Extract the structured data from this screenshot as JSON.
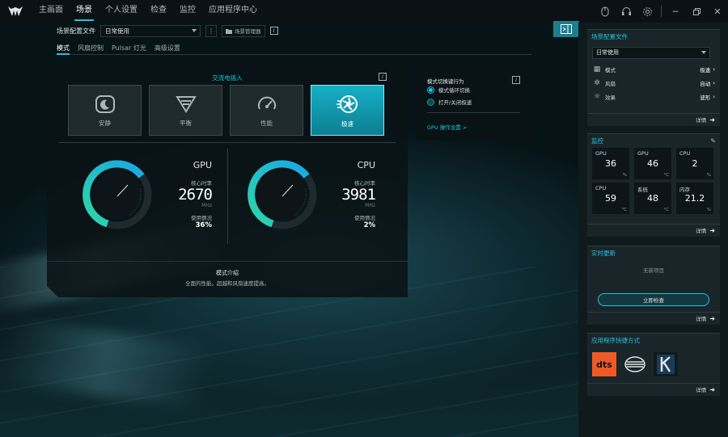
{
  "topbar": {
    "nav": [
      "主画面",
      "场景",
      "个人设置",
      "检查",
      "监控",
      "应用程序中心"
    ],
    "active_nav": "场景",
    "window_controls": [
      "minimize-icon",
      "maximize-icon",
      "close-icon"
    ],
    "icons": [
      "mouse-icon",
      "headset-icon",
      "gear-icon"
    ]
  },
  "profile": {
    "label": "场景配置文件",
    "selected": "日常使用",
    "more": "⋮",
    "manager": "场景管理器"
  },
  "subtabs": [
    "模式",
    "风扇控制",
    "Pulsar 灯光",
    "高级设置"
  ],
  "main": {
    "power_status": "交流电插入",
    "modes": [
      {
        "label": "安静",
        "icon": "quiet-icon"
      },
      {
        "label": "平衡",
        "icon": "balance-icon"
      },
      {
        "label": "性能",
        "icon": "performance-icon"
      },
      {
        "label": "极速",
        "icon": "turbo-icon"
      }
    ],
    "active_mode": "极速",
    "gpu": {
      "title": "GPU",
      "clock_label": "核心时率",
      "clock": "2670",
      "unit": "MHz",
      "usage_label": "使用情况",
      "usage": "36%",
      "usage_value": 36
    },
    "cpu": {
      "title": "CPU",
      "clock_label": "核心时率",
      "clock": "3981",
      "unit": "MHz",
      "usage_label": "使用情况",
      "usage": "2%",
      "usage_value": 2
    },
    "desc_title": "模式介绍",
    "desc_text": "全面的性能。超越和风扇速度提高。"
  },
  "switch": {
    "title": "模式切换键行为",
    "opt1": "模式循环切换",
    "opt2": "打开/关闭极速",
    "gpu_link": "GPU 操作设置 >"
  },
  "right": {
    "profile_card": {
      "title": "场景配置文件",
      "selected": "日常使用",
      "rows": [
        {
          "icon": "gauge-icon",
          "label": "模式",
          "value": "极速"
        },
        {
          "icon": "fan-icon",
          "label": "风扇",
          "value": "自动"
        },
        {
          "icon": "light-icon",
          "label": "效果",
          "value": "波形"
        }
      ],
      "details": "详情"
    },
    "monitor_card": {
      "title": "监控",
      "stats": [
        {
          "label": "GPU",
          "value": "36",
          "unit": "%"
        },
        {
          "label": "GPU",
          "value": "46",
          "unit": "°C"
        },
        {
          "label": "CPU",
          "value": "2",
          "unit": "%"
        },
        {
          "label": "CPU",
          "value": "59",
          "unit": "°C"
        },
        {
          "label": "系统",
          "value": "48",
          "unit": "°C"
        },
        {
          "label": "内存",
          "value": "21.2",
          "unit": "%"
        }
      ],
      "details": "详情"
    },
    "update_card": {
      "title": "实时更新",
      "empty": "无新项目",
      "button": "立即检查",
      "details": "详情"
    },
    "apps_card": {
      "title": "应用程序快捷方式",
      "apps": [
        "dts",
        "app2",
        "K"
      ],
      "details": "详情"
    }
  },
  "colors": {
    "accent": "#1fc6e0",
    "gauge_start": "#2ed6a8",
    "gauge_end": "#19a6e6"
  }
}
